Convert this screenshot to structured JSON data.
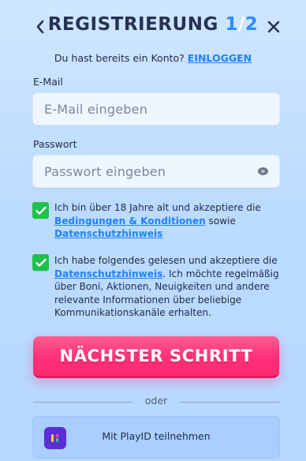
{
  "header": {
    "title_prefix": "REGISTRIERUNG ",
    "step_current": "1",
    "step_sep": "/",
    "step_total": "2",
    "back_icon": "chevron-left-icon",
    "close_icon": "close-icon"
  },
  "login": {
    "question": "Du hast bereits ein Konto? ",
    "link": "EINLOGGEN"
  },
  "email": {
    "label": "E-Mail",
    "placeholder": "E-Mail eingeben"
  },
  "password": {
    "label": "Passwort",
    "placeholder": "Passwort eingeben",
    "toggle_icon": "eye-icon"
  },
  "consents": [
    {
      "checked": true,
      "text_before": "Ich bin über 18 Jahre alt und akzeptiere die ",
      "link1": "Bedingungen & Konditionen",
      "text_mid": " sowie ",
      "link2": "Datenschutzhinweis"
    },
    {
      "checked": true,
      "text_before": "Ich habe folgendes gelesen und akzeptiere die ",
      "link1": "Datenschutzhinweis",
      "text_after": ". Ich möchte regelmäßig über Boni, Aktionen, Neuigkeiten und andere relevante Informationen über beliebige Kommunikationskanäle erhalten."
    }
  ],
  "cta": {
    "label": "NÄCHSTER SCHRITT"
  },
  "divider": {
    "label": "oder"
  },
  "playid": {
    "label": "Mit PlayID teilnehmen",
    "icon": "playid-logo-icon"
  },
  "colors": {
    "accent": "#ff2f79",
    "link": "#1d82ff",
    "check": "#1ec24a"
  }
}
